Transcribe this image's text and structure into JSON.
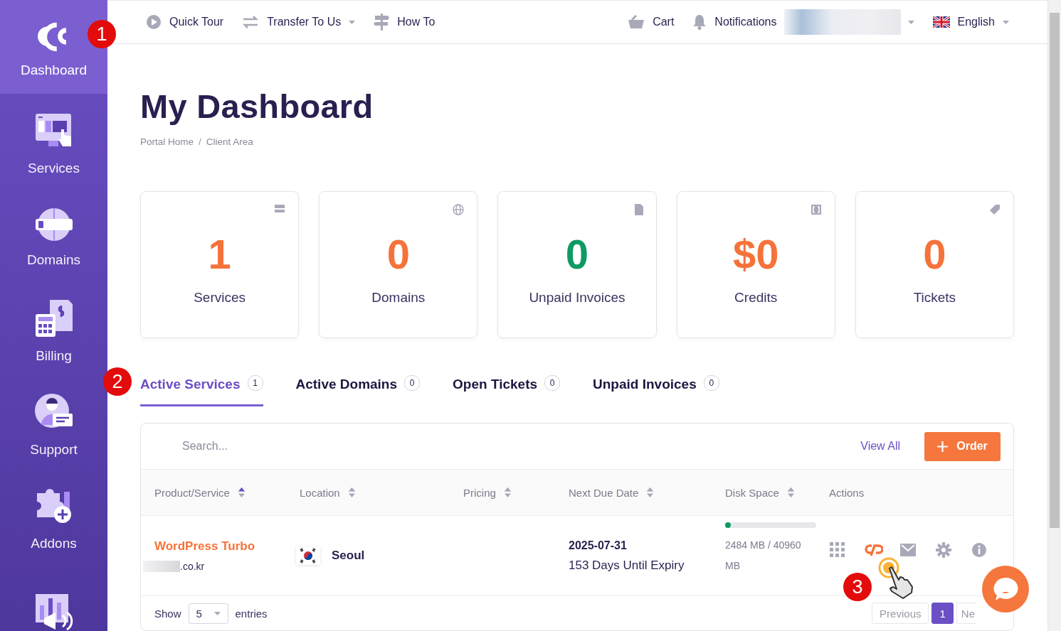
{
  "sidebar": {
    "items": [
      {
        "label": "Dashboard",
        "selected": true
      },
      {
        "label": "Services",
        "selected": false
      },
      {
        "label": "Domains",
        "selected": false
      },
      {
        "label": "Billing",
        "selected": false
      },
      {
        "label": "Support",
        "selected": false
      },
      {
        "label": "Addons",
        "selected": false
      },
      {
        "selected": false
      }
    ]
  },
  "topbar": {
    "left": [
      {
        "label": "Quick Tour",
        "dropdown": false
      },
      {
        "label": "Transfer To Us",
        "dropdown": true
      },
      {
        "label": "How To",
        "dropdown": false
      }
    ],
    "right": [
      {
        "label": "Cart"
      },
      {
        "label": "Notifications"
      }
    ],
    "language": "English"
  },
  "page": {
    "title": "My Dashboard",
    "breadcrumb": [
      "Portal Home",
      "Client Area"
    ],
    "breadcrumb_separator": "/"
  },
  "stats": [
    {
      "value": "1",
      "label": "Services",
      "color": "#f5733a"
    },
    {
      "value": "0",
      "label": "Domains",
      "color": "#f5733a"
    },
    {
      "value": "0",
      "label": "Unpaid Invoices",
      "color": "#0e9a63"
    },
    {
      "value": "$0",
      "label": "Credits",
      "color": "#f5733a"
    },
    {
      "value": "0",
      "label": "Tickets",
      "color": "#f5733a"
    }
  ],
  "tabs": [
    {
      "label": "Active Services",
      "count": "1",
      "selected": true
    },
    {
      "label": "Active Domains",
      "count": "0",
      "selected": false
    },
    {
      "label": "Open Tickets",
      "count": "0",
      "selected": false
    },
    {
      "label": "Unpaid Invoices",
      "count": "0",
      "selected": false
    }
  ],
  "services": {
    "search": {
      "placeholder": "Search..."
    },
    "view_all": "View All",
    "order_button": "Order",
    "columns": [
      {
        "label": "Product/Service",
        "sortable": true
      },
      {
        "label": "Location",
        "sortable": true
      },
      {
        "label": "Pricing",
        "sortable": true
      },
      {
        "label": "Next Due Date",
        "sortable": true
      },
      {
        "label": "Disk Space",
        "sortable": true
      },
      {
        "label": "Actions",
        "sortable": false
      }
    ],
    "rows": [
      {
        "product": "WordPress Turbo",
        "domain": ".co.kr",
        "location": "Seoul",
        "due_date": "2025-07-31",
        "days_left": "153 Days Until Expiry",
        "disk": {
          "level": 0.06,
          "reading": "2484 MB / 40960 MB"
        }
      }
    ],
    "show_label": "Show",
    "page_size": "5",
    "entries_label": "entries",
    "pagination": [
      {
        "label": "Previous",
        "kind": "prev",
        "disabled": true,
        "selected": false
      },
      {
        "label": "1",
        "kind": "page",
        "disabled": false,
        "selected": true
      },
      {
        "label": "Ne",
        "kind": "next",
        "disabled": true,
        "selected": false
      }
    ]
  },
  "annotations": [
    {
      "number": "1"
    },
    {
      "number": "2"
    },
    {
      "number": "3"
    }
  ]
}
